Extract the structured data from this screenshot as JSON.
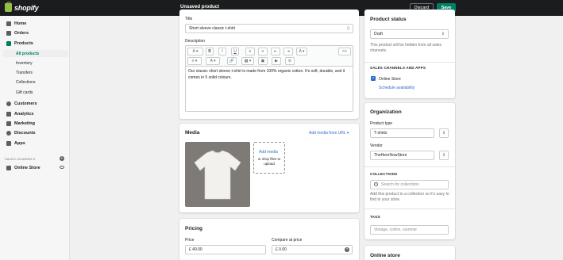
{
  "topbar": {
    "logo_text": "shopify",
    "status_title": "Unsaved product",
    "discard_label": "Discard",
    "save_label": "Save"
  },
  "sidebar": {
    "items": [
      {
        "label": "Home",
        "icon": "home-icon"
      },
      {
        "label": "Orders",
        "icon": "orders-icon"
      },
      {
        "label": "Products",
        "icon": "tag-icon"
      },
      {
        "label": "Customers",
        "icon": "person-icon"
      },
      {
        "label": "Analytics",
        "icon": "analytics-icon"
      },
      {
        "label": "Marketing",
        "icon": "marketing-icon"
      },
      {
        "label": "Discounts",
        "icon": "discount-icon"
      },
      {
        "label": "Apps",
        "icon": "apps-icon"
      },
      {
        "label": "Online Store",
        "icon": "store-icon"
      }
    ],
    "product_subitems": [
      "All products",
      "Inventory",
      "Transfers",
      "Collections",
      "Gift cards"
    ],
    "sales_channels_label": "SALES CHANNELS"
  },
  "product_form": {
    "title_label": "Title",
    "title_value": "Short sleeve classic t-shirt",
    "description_label": "Description",
    "description_text": "Our classic short sleeve t-shirt is made from 100% organic cotton. It's soft, durable, and it comes in 5 solid colours.",
    "toolbar_row1": [
      "A ▾",
      "B",
      "I",
      "U",
      "≡",
      "≡",
      "⇤",
      "⇥",
      "A ▾",
      "<>"
    ],
    "toolbar_row2": [
      "≡ ▾",
      "A ▾",
      "🔗",
      "▦ ▾",
      "▣",
      "▶",
      "⊘"
    ]
  },
  "media": {
    "heading": "Media",
    "add_from_url": "Add media from URL ▾",
    "add_media": "Add media",
    "drop_hint": "or drop files to upload"
  },
  "pricing": {
    "heading": "Pricing",
    "price_label": "Price",
    "price_value": "£  40.00",
    "compare_label": "Compare at price",
    "compare_value": "£  0.00"
  },
  "product_status": {
    "heading": "Product status",
    "status_value": "Draft",
    "hidden_note": "This product will be hidden from all sales channels.",
    "channels_cap": "SALES CHANNELS AND APPS",
    "online_store": "Online Store",
    "schedule": "Schedule availability"
  },
  "organization": {
    "heading": "Organization",
    "type_label": "Product type",
    "type_value": "T-shirts",
    "vendor_label": "Vendor",
    "vendor_value": "TheHereNowStore",
    "collections_cap": "COLLECTIONS",
    "collections_placeholder": "Search for collections",
    "collections_note": "Add this product to a collection so it's easy to find in your store.",
    "tags_cap": "TAGS",
    "tags_placeholder": "Vintage, cotton, summer"
  },
  "online_store_card": {
    "heading": "Online store"
  },
  "colors": {
    "save": "#008060",
    "topbar": "#1a1c1d",
    "link": "#2c6ecb",
    "active_nav": "#008060"
  }
}
